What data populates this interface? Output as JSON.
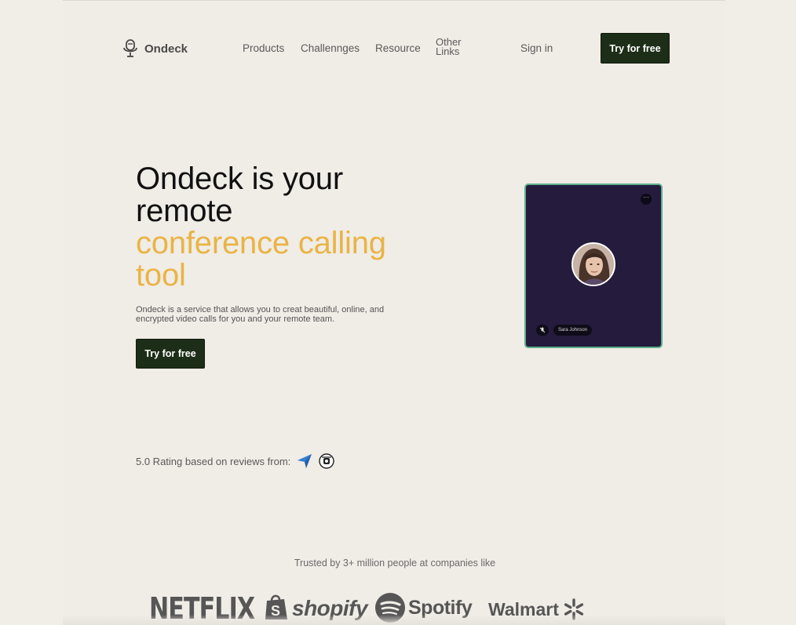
{
  "nav": {
    "logo_text": "Ondeck",
    "links": [
      "Products",
      "Challennges",
      "Resource"
    ],
    "other_links": [
      "Other",
      "Links"
    ],
    "sign_in": "Sign in",
    "cta": "Try for free"
  },
  "hero": {
    "title_line1": "Ondeck is your",
    "title_line2": "remote",
    "title_accent_line1": "conference calling",
    "title_accent_line2": "tool",
    "description": "Ondeck is a service that allows you to creat beautiful, online, and encrypted video calls for you and your remote team.",
    "cta": "Try for free"
  },
  "call_card": {
    "more_label": "···",
    "participant_name": "Sara Johnson"
  },
  "rating": {
    "text": "5.0 Rating based on reviews from:"
  },
  "trusted": {
    "text": "Trusted by 3+ million people at companies like",
    "companies": [
      "NETFLIX",
      "shopify",
      "Spotify",
      "Walmart"
    ]
  },
  "colors": {
    "background": "#f1ede7",
    "primary_button": "#1c2e17",
    "accent": "#e9b445",
    "card_bg": "#241b3d",
    "card_border": "#5fb08c"
  }
}
